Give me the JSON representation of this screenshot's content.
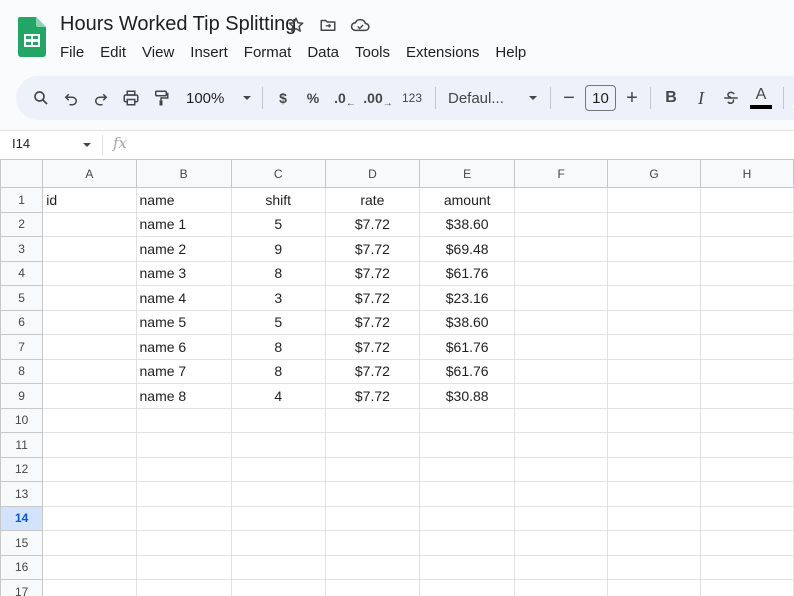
{
  "app": {
    "title": "Hours Worked Tip Splitting",
    "brand_color": "#188038"
  },
  "menu": [
    "File",
    "Edit",
    "View",
    "Insert",
    "Format",
    "Data",
    "Tools",
    "Extensions",
    "Help"
  ],
  "toolbar": {
    "zoom": "100%",
    "currency": "$",
    "percent": "%",
    "dec_decrease": ".0",
    "dec_increase": ".00",
    "number_format": "123",
    "font": "Defaul...",
    "font_size": "10",
    "minus": "−",
    "plus": "+",
    "bold": "B",
    "italic": "I",
    "text_color": "A",
    "icons": [
      "search-icon",
      "undo-icon",
      "redo-icon",
      "print-icon",
      "paint-format-icon",
      "strikethrough-icon",
      "fill-color-icon"
    ]
  },
  "formula_bar": {
    "name_box": "I14",
    "fx": "fx",
    "value": ""
  },
  "grid": {
    "columns": [
      "A",
      "B",
      "C",
      "D",
      "E",
      "F",
      "G",
      "H"
    ],
    "row_numbers": [
      "1",
      "2",
      "3",
      "4",
      "5",
      "6",
      "7",
      "8",
      "9",
      "10",
      "11",
      "12",
      "13",
      "14",
      "15",
      "16",
      "17"
    ],
    "selected_row": "14",
    "selected_cell": "I14",
    "rows": [
      [
        "id",
        "name",
        "shift",
        "rate",
        "amount",
        "",
        "",
        ""
      ],
      [
        "",
        "name 1",
        "5",
        "$7.72",
        "$38.60",
        "",
        "",
        ""
      ],
      [
        "",
        "name 2",
        "9",
        "$7.72",
        "$69.48",
        "",
        "",
        ""
      ],
      [
        "",
        "name 3",
        "8",
        "$7.72",
        "$61.76",
        "",
        "",
        ""
      ],
      [
        "",
        "name 4",
        "3",
        "$7.72",
        "$23.16",
        "",
        "",
        ""
      ],
      [
        "",
        "name 5",
        "5",
        "$7.72",
        "$38.60",
        "",
        "",
        ""
      ],
      [
        "",
        "name 6",
        "8",
        "$7.72",
        "$61.76",
        "",
        "",
        ""
      ],
      [
        "",
        "name 7",
        "8",
        "$7.72",
        "$61.76",
        "",
        "",
        ""
      ],
      [
        "",
        "name 8",
        "4",
        "$7.72",
        "$30.88",
        "",
        "",
        ""
      ],
      [
        "",
        "",
        "",
        "",
        "",
        "",
        "",
        ""
      ],
      [
        "",
        "",
        "",
        "",
        "",
        "",
        "",
        ""
      ],
      [
        "",
        "",
        "",
        "",
        "",
        "",
        "",
        ""
      ],
      [
        "",
        "",
        "",
        "",
        "",
        "",
        "",
        ""
      ],
      [
        "",
        "",
        "",
        "",
        "",
        "",
        "",
        ""
      ],
      [
        "",
        "",
        "",
        "",
        "",
        "",
        "",
        ""
      ],
      [
        "",
        "",
        "",
        "",
        "",
        "",
        "",
        ""
      ],
      [
        "",
        "",
        "",
        "",
        "",
        "",
        "",
        ""
      ]
    ]
  }
}
